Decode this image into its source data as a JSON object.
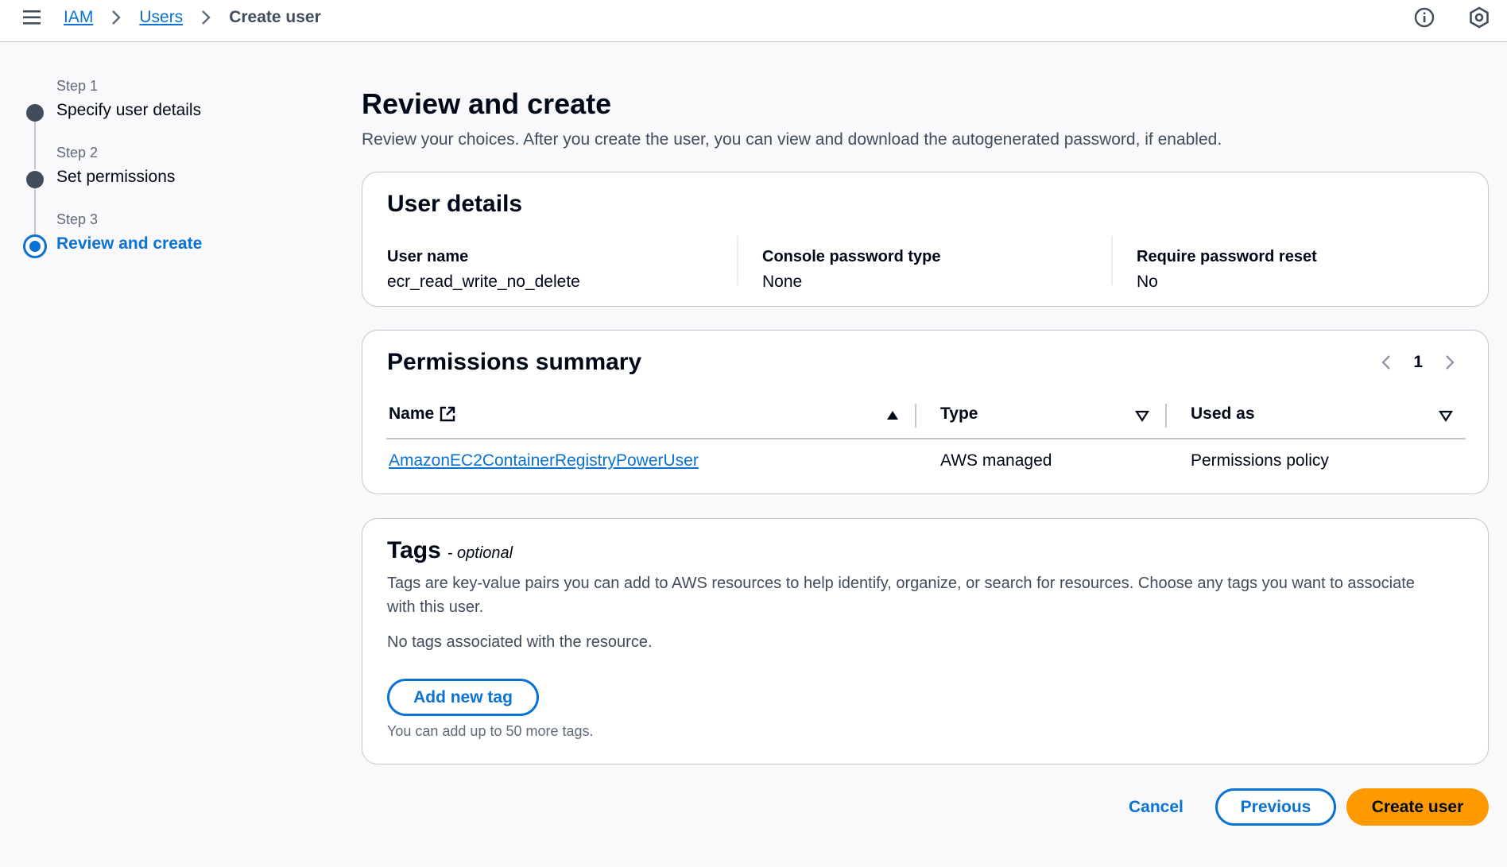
{
  "breadcrumbs": {
    "iam": "IAM",
    "users": "Users",
    "current": "Create user"
  },
  "icons": {
    "menu": "menu-icon",
    "separator": "chevron-right-icon",
    "info": "info-icon",
    "settings": "settings-hexagon-icon"
  },
  "steps": [
    {
      "number": "Step 1",
      "title": "Specify user details",
      "state": "complete"
    },
    {
      "number": "Step 2",
      "title": "Set permissions",
      "state": "complete"
    },
    {
      "number": "Step 3",
      "title": "Review and create",
      "state": "active"
    }
  ],
  "page": {
    "title": "Review and create",
    "description": "Review your choices. After you create the user, you can view and download the autogenerated password, if enabled."
  },
  "user_details": {
    "title": "User details",
    "fields": [
      {
        "label": "User name",
        "value": "ecr_read_write_no_delete"
      },
      {
        "label": "Console password type",
        "value": "None"
      },
      {
        "label": "Require password reset",
        "value": "No"
      }
    ]
  },
  "permissions": {
    "title": "Permissions summary",
    "page": "1",
    "columns": [
      "Name",
      "Type",
      "Used as"
    ],
    "rows": [
      {
        "name": "AmazonEC2ContainerRegistryPowerUser",
        "type": "AWS managed",
        "used_as": "Permissions policy"
      }
    ]
  },
  "tags": {
    "title": "Tags",
    "optional": "- optional",
    "description": "Tags are key-value pairs you can add to AWS resources to help identify, organize, or search for resources. Choose any tags you want to associate with this user.",
    "empty": "No tags associated with the resource.",
    "add_button": "Add new tag",
    "hint": "You can add up to 50 more tags."
  },
  "actions": {
    "cancel": "Cancel",
    "previous": "Previous",
    "create": "Create user"
  },
  "colors": {
    "accent": "#0972d3",
    "primary_button": "#ff9900",
    "text": "#000716",
    "muted": "#414d5c"
  }
}
